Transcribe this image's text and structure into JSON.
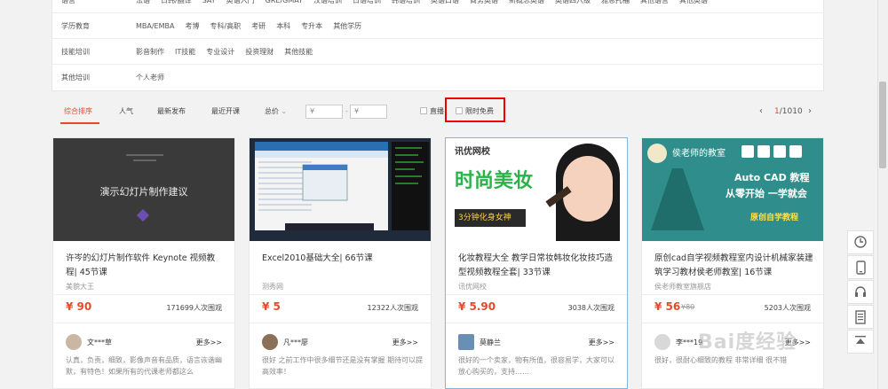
{
  "categories": [
    {
      "label": "语言",
      "items": [
        "法语",
        "日韩/翻译",
        "SAT",
        "英语入门",
        "GRE/GMAT",
        "汉语培训",
        "日语培训",
        "韩语培训",
        "英语口语",
        "商务英语",
        "新概念英语",
        "英语四六级",
        "雅思托福",
        "其他语言",
        "其他英语"
      ]
    },
    {
      "label": "学历教育",
      "items": [
        "MBA/EMBA",
        "考博",
        "专科/高职",
        "考研",
        "本科",
        "专升本",
        "其他学历"
      ]
    },
    {
      "label": "技能培训",
      "items": [
        "影音制作",
        "IT技能",
        "专业设计",
        "投资理财",
        "其他技能"
      ]
    },
    {
      "label": "其他培训",
      "items": [
        "个人老师"
      ]
    }
  ],
  "sort": {
    "comprehensive": "综合排序",
    "popularity": "人气",
    "latest": "最新发布",
    "recent_start": "最近开课",
    "total_price": "总价",
    "price_from": "¥",
    "price_to": "¥",
    "live": "直播",
    "free": "限时免费",
    "page_current": "1",
    "page_total": "/1010"
  },
  "cards": [
    {
      "thumb_text": "演示幻灯片制作建议",
      "title": "许岑的幻灯片制作软件 Keynote 视频教程| 45节课",
      "provider": "美貌大王",
      "price": "¥ 90",
      "old_price": "",
      "views": "171699人次围观",
      "user": "文***草",
      "more": "更多>>",
      "comment": "认真，负责，细致，影像声音有品质，语言诙谐幽默，有特色！如果所有的代课老师都这么"
    },
    {
      "thumb_text": "",
      "title": "Excel2010基础大全| 66节课",
      "provider": "测秀网",
      "price": "¥ 5",
      "old_price": "",
      "views": "12322人次围观",
      "user": "凡***廖",
      "more": "更多>>",
      "comment": "很好 之前工作中很多细节还是没有掌握 期待可以提高效率！"
    },
    {
      "thumb_text_brand": "讯优网校",
      "thumb_text": "时尚美妆",
      "thumb_subtitle": "3分钟化身女神",
      "title": "化妆教程大全 教学日常妆韩妆化妆技巧造型视频教程全套| 33节课",
      "provider": "讯优网校",
      "price": "¥ 5.90",
      "old_price": "",
      "views": "3038人次围观",
      "user": "莫静兰",
      "more": "更多>>",
      "comment": "很好的一个卖家，物有所值，很容易学，大家可以放心购买的，支持……"
    },
    {
      "thumb_text_brand": "侯老师的教室",
      "thumb_text": "Auto CAD 教程",
      "thumb_subtitle": "从零开始  一学就会",
      "thumb_badge": "原创自学教程",
      "title": "原创cad自学视频教程室内设计机械家装建筑学习教材侯老师教室| 16节课",
      "provider": "侯老师教室旗舰店",
      "price": "¥ 56",
      "old_price": "¥80",
      "views": "5203人次围观",
      "user": "李***19",
      "more": "更多>>",
      "comment": "很好，很耐心细致的教程 非常详细 很不错"
    }
  ],
  "watermark": "Bai度经验",
  "colors": {
    "accent": "#e14b2b",
    "highlight": "#e00000"
  }
}
